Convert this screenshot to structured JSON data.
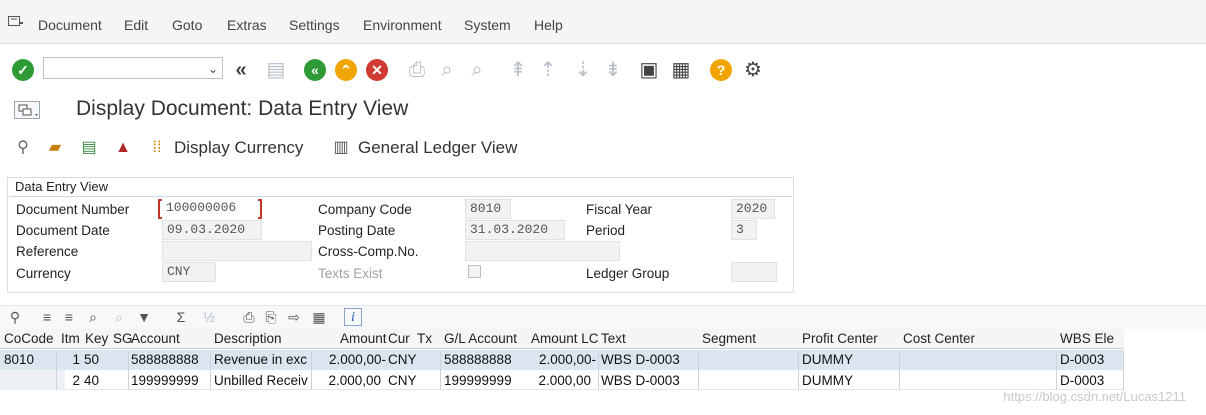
{
  "menu": {
    "items": [
      "Document",
      "Edit",
      "Goto",
      "Extras",
      "Settings",
      "Environment",
      "System",
      "Help"
    ]
  },
  "toolbar": {
    "command_field_value": "",
    "icons": [
      "check-icon",
      "back-double-icon",
      "save-icon",
      "back-icon",
      "exit-icon",
      "cancel-icon",
      "print-icon",
      "find-icon",
      "find-next-icon",
      "first-page-icon",
      "prev-page-icon",
      "next-page-icon",
      "last-page-icon",
      "new-session-icon",
      "shortcut-icon",
      "help-icon",
      "settings-icon"
    ]
  },
  "title": "Display Document: Data Entry View",
  "app_toolbar": {
    "display_currency": "Display Currency",
    "general_ledger_view": "General Ledger View"
  },
  "header_group": {
    "title": "Data Entry View",
    "document_number_label": "Document Number",
    "document_number": "100000006",
    "company_code_label": "Company Code",
    "company_code": "8010",
    "fiscal_year_label": "Fiscal Year",
    "fiscal_year": "2020",
    "document_date_label": "Document Date",
    "document_date": "09.03.2020",
    "posting_date_label": "Posting Date",
    "posting_date": "31.03.2020",
    "period_label": "Period",
    "period": "3",
    "reference_label": "Reference",
    "reference": "",
    "cross_comp_label": "Cross-Comp.No.",
    "cross_comp": "",
    "currency_label": "Currency",
    "currency": "CNY",
    "texts_exist_label": "Texts Exist",
    "ledger_group_label": "Ledger Group",
    "ledger_group": ""
  },
  "table": {
    "headers": [
      "CoCode",
      "Itm",
      "Key",
      "SG",
      "Account",
      "Description",
      "Amount",
      "Cur",
      "Tx",
      "G/L Account",
      "Amount LC",
      "Text",
      "Segment",
      "Profit Center",
      "Cost Center",
      "WBS Ele"
    ],
    "rows": [
      {
        "cocode": "8010",
        "itm": "1",
        "key": "50",
        "sg": "",
        "account": "588888888",
        "description": "Revenue in exc",
        "amount": "2.000,00-",
        "cur": "CNY",
        "tx": "",
        "gl_account": "588888888",
        "amount_lc": "2.000,00-",
        "text": "WBS D-0003",
        "segment": "",
        "profit_center": "DUMMY",
        "cost_center": "",
        "wbs": "D-0003"
      },
      {
        "cocode": "",
        "itm": "2",
        "key": "40",
        "sg": "",
        "account": "199999999",
        "description": "Unbilled Receiv",
        "amount": "2.000,00",
        "cur": "CNY",
        "tx": "",
        "gl_account": "199999999",
        "amount_lc": "2.000,00",
        "text": "WBS D-0003",
        "segment": "",
        "profit_center": "DUMMY",
        "cost_center": "",
        "wbs": "D-0003"
      }
    ]
  },
  "watermark": "https://blog.csdn.net/Lucas1211"
}
